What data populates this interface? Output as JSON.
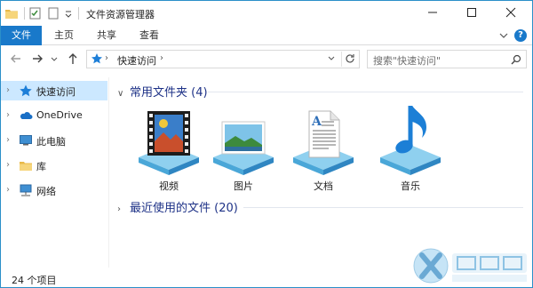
{
  "titlebar": {
    "title": "文件资源管理器",
    "qat_icons": [
      "folder-icon",
      "properties-icon",
      "new-folder-icon",
      "customize-chevron-icon"
    ]
  },
  "ribbon": {
    "tabs": [
      {
        "label": "文件"
      },
      {
        "label": "主页"
      },
      {
        "label": "共享"
      },
      {
        "label": "查看"
      }
    ]
  },
  "navigation": {
    "address": "快速访问",
    "search_placeholder": "搜索\"快速访问\""
  },
  "sidebar": {
    "items": [
      {
        "label": "快速访问",
        "icon": "star-icon",
        "selected": true
      },
      {
        "label": "OneDrive",
        "icon": "cloud-icon"
      },
      {
        "label": "此电脑",
        "icon": "computer-icon"
      },
      {
        "label": "库",
        "icon": "library-icon"
      },
      {
        "label": "网络",
        "icon": "network-icon"
      }
    ]
  },
  "content": {
    "frequent_header": "常用文件夹 (4)",
    "recent_header": "最近使用的文件 (20)",
    "folders": [
      {
        "label": "视频",
        "icon": "video-folder-icon"
      },
      {
        "label": "图片",
        "icon": "pictures-folder-icon"
      },
      {
        "label": "文档",
        "icon": "documents-folder-icon"
      },
      {
        "label": "音乐",
        "icon": "music-folder-icon"
      }
    ]
  },
  "status": {
    "item_count": "24 个项目"
  },
  "colors": {
    "accent": "#1979ca",
    "selection": "#cce8ff",
    "group_header": "#1e3287"
  }
}
